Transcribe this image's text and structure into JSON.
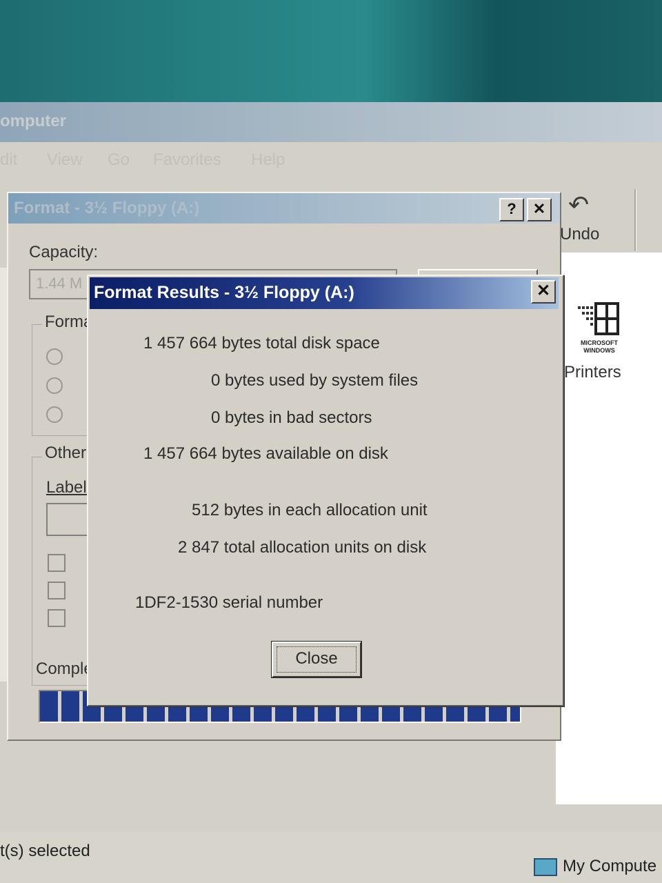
{
  "explorer": {
    "title": "omputer",
    "menu": [
      "dit",
      "View",
      "Go",
      "Favorites",
      "Help"
    ],
    "toolbar": {
      "undo_label": "Undo"
    },
    "printers_label": "Printers",
    "logo_text": "MICROSOFT WINDOWS",
    "status_left": "t(s) selected",
    "status_right": "My Compute"
  },
  "format_dialog": {
    "title": "Format - 3½ Floppy (A:)",
    "help_btn": "?",
    "close_btn": "✕",
    "capacity_label": "Capacity:",
    "capacity_value": "1.44 M",
    "format_group": "Forma",
    "other_group": "Other",
    "label_text": "Label:",
    "completed_label": "Complet",
    "progress_percent": 100
  },
  "results_dialog": {
    "title": "Format Results - 3½ Floppy (A:)",
    "close_x": "✕",
    "total_space": "1 457 664 bytes total disk space",
    "system_files": "0 bytes used by system files",
    "bad_sectors": "0 bytes in bad sectors",
    "available": "1 457 664 bytes available on disk",
    "alloc_unit": "512 bytes in each allocation unit",
    "alloc_total": "2 847 total allocation units on disk",
    "serial": "1DF2-1530 serial number",
    "close_button": "Close"
  }
}
